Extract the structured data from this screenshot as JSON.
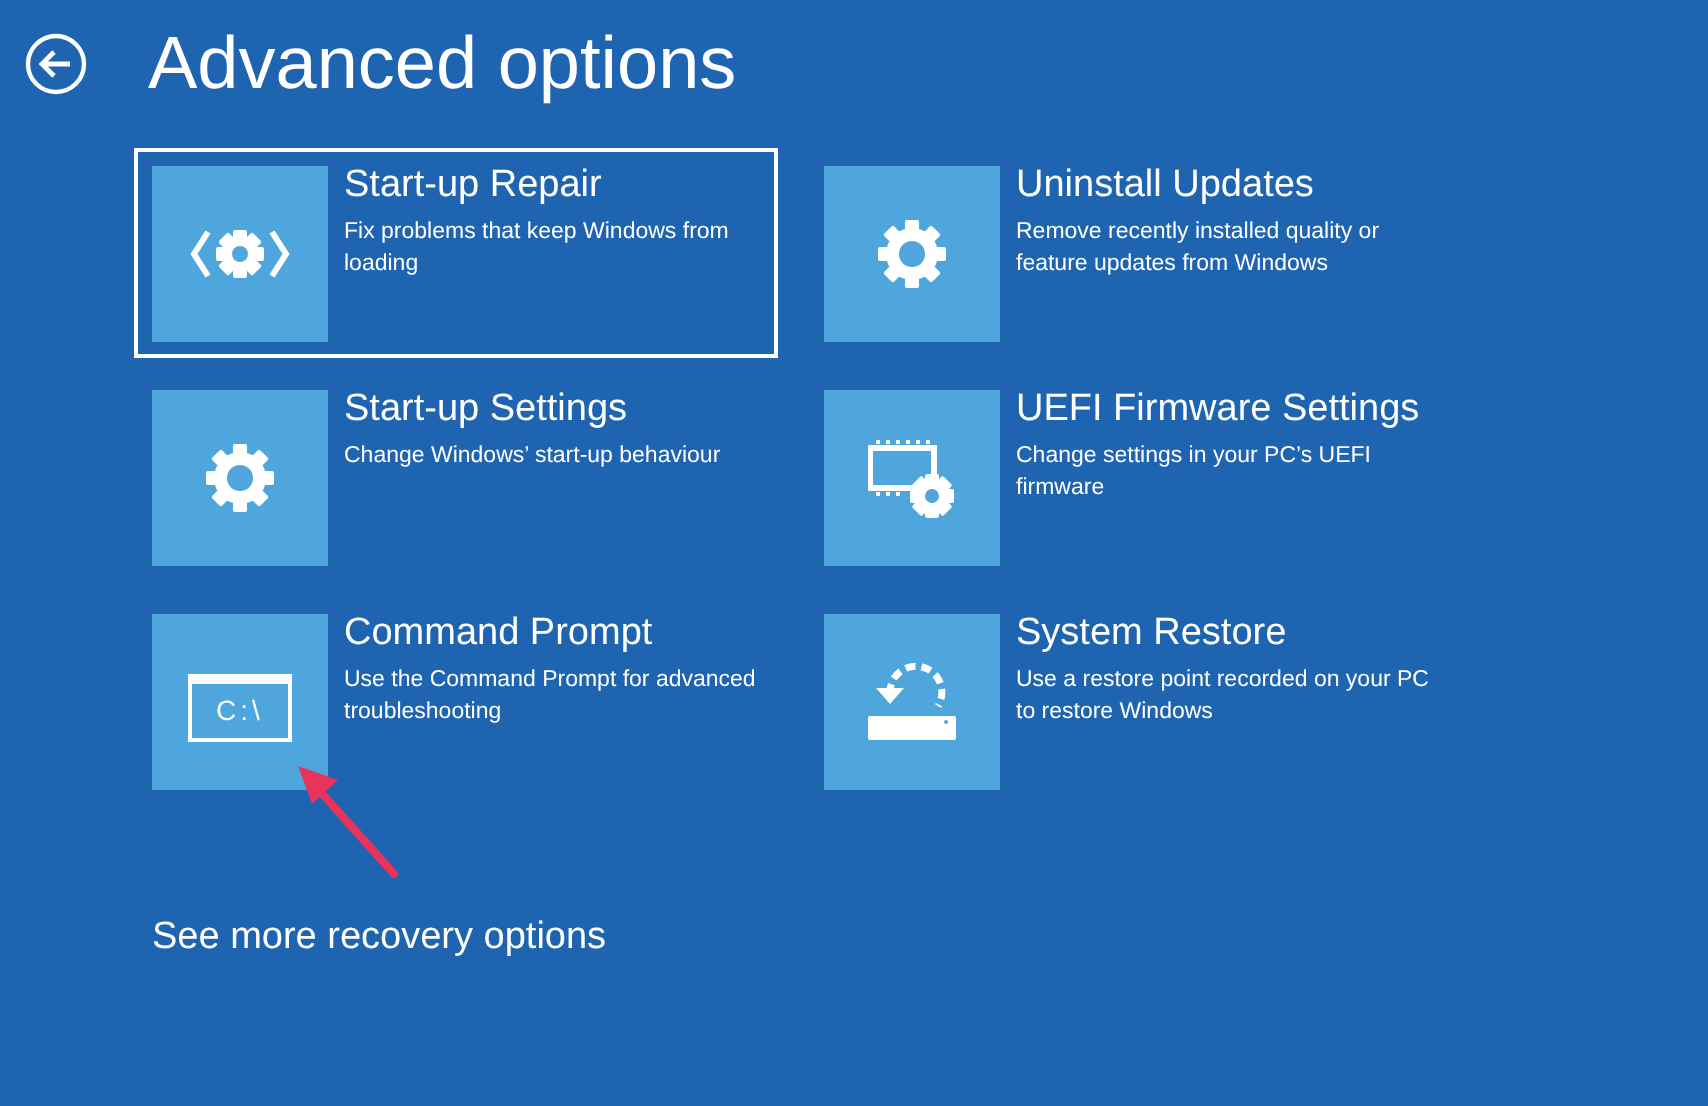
{
  "page": {
    "title": "Advanced options"
  },
  "options": [
    {
      "title": "Start-up Repair",
      "description": "Fix problems that keep Windows from loading",
      "kind": "repair",
      "selected": true
    },
    {
      "title": "Uninstall Updates",
      "description": "Remove recently installed quality or feature updates from Windows",
      "kind": "gear",
      "selected": false
    },
    {
      "title": "Start-up Settings",
      "description": "Change Windows’ start-up behaviour",
      "kind": "gear",
      "selected": false
    },
    {
      "title": "UEFI Firmware Settings",
      "description": "Change settings in your PC’s UEFI firmware",
      "kind": "firmware",
      "selected": false
    },
    {
      "title": "Command Prompt",
      "description": "Use the Command Prompt for advanced troubleshooting",
      "kind": "cmd",
      "icon_text": "C:\\",
      "selected": false
    },
    {
      "title": "System Restore",
      "description": "Use a restore point recorded on your PC to restore Windows",
      "kind": "restore",
      "selected": false
    }
  ],
  "more_link": "See more recovery options"
}
